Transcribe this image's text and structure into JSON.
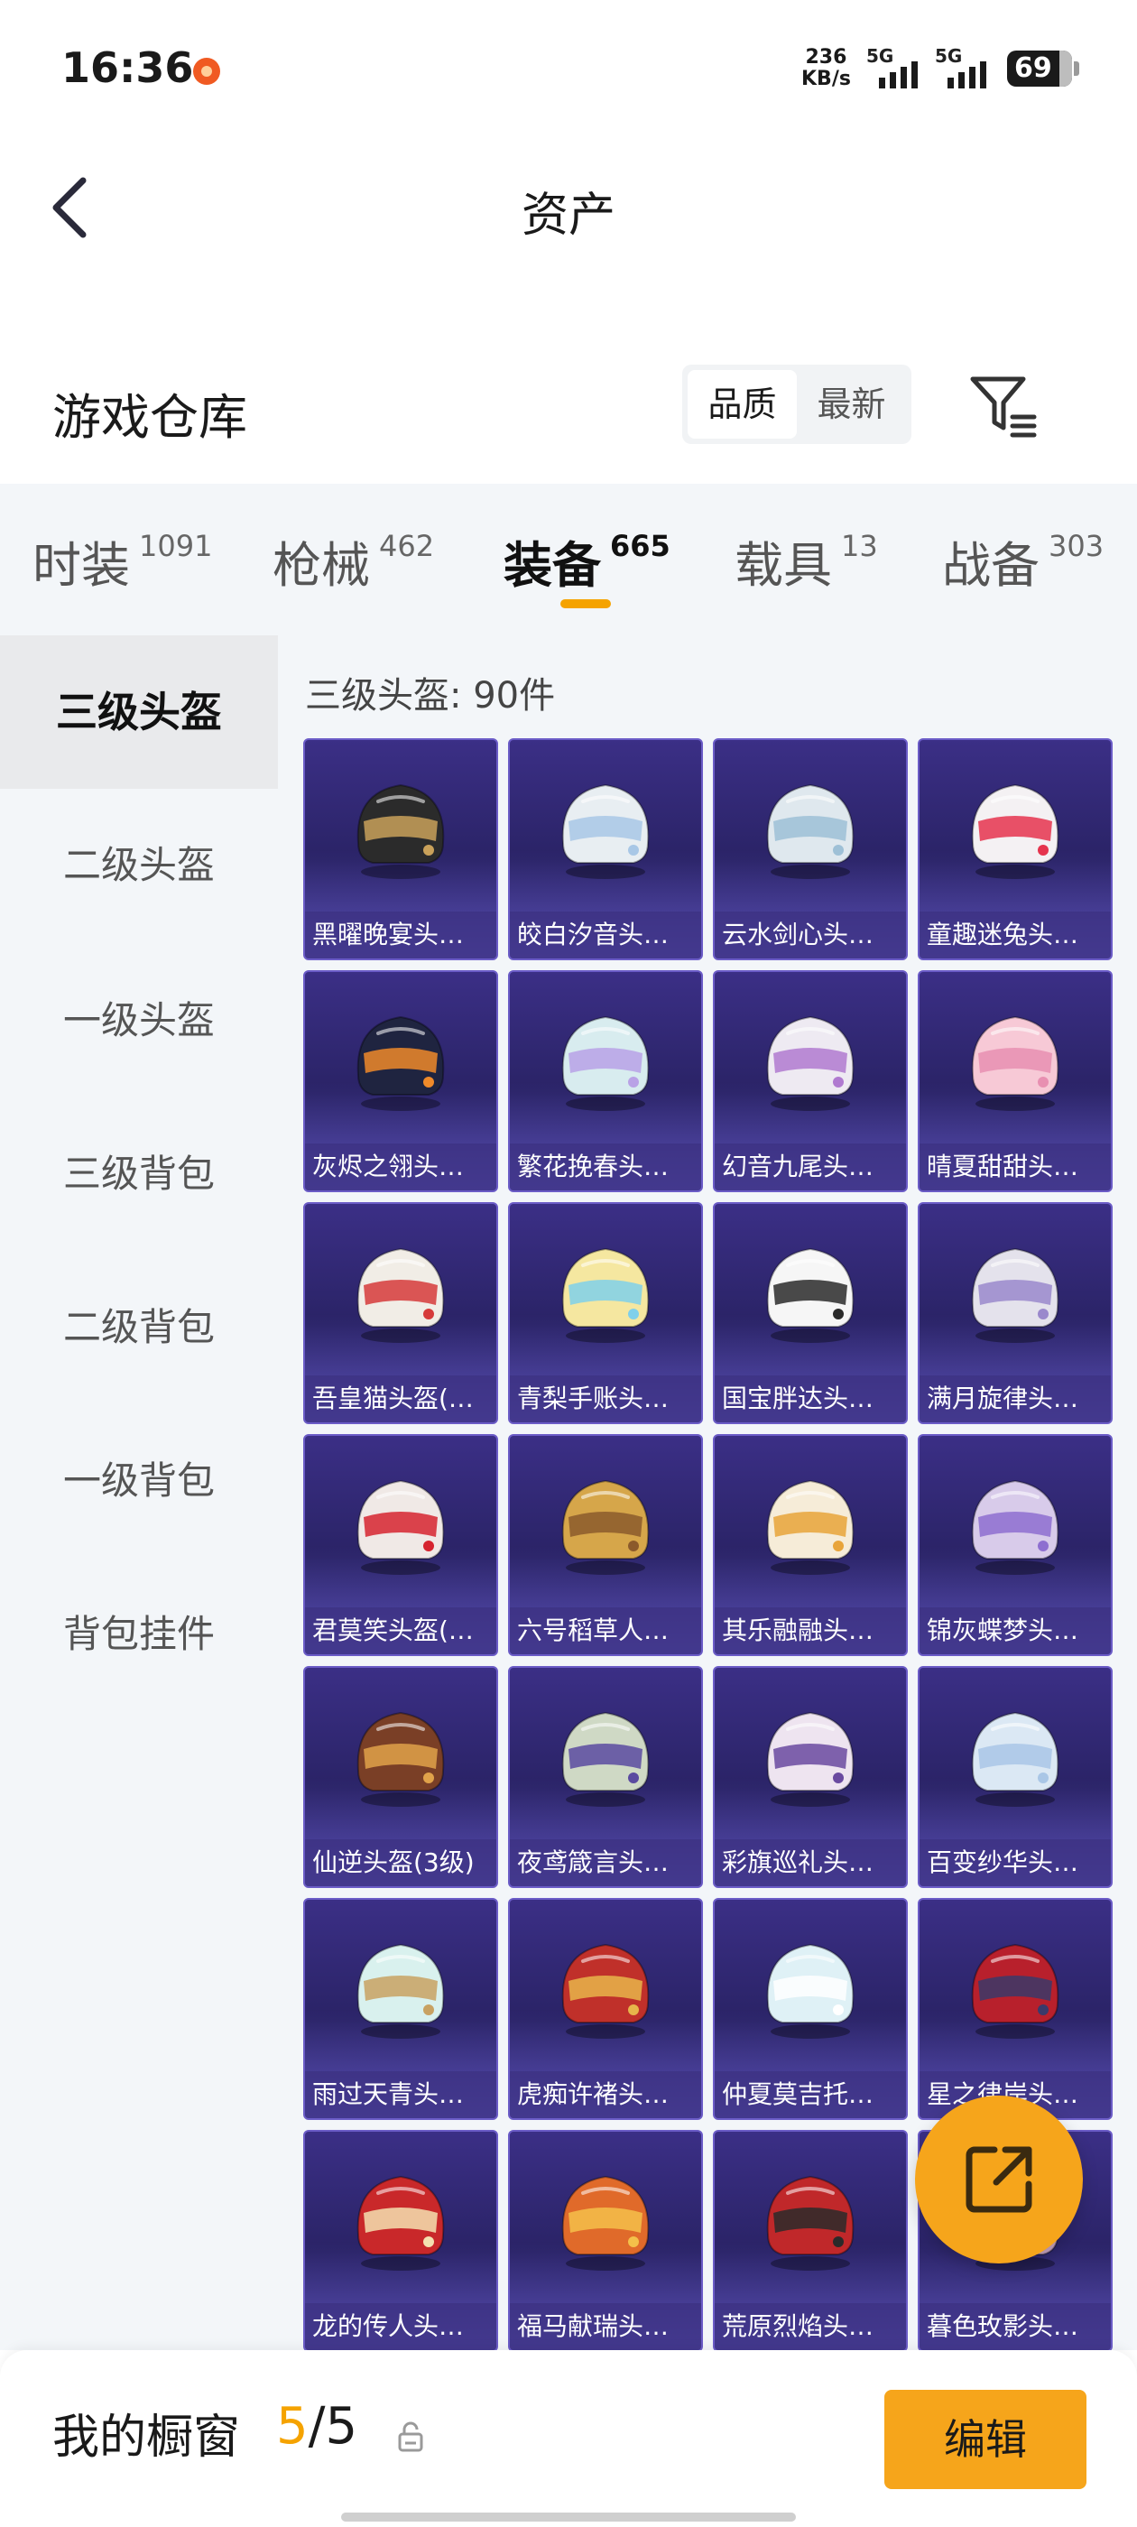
{
  "status_bar": {
    "time": "16:36",
    "net_speed_value": "236",
    "net_speed_unit": "KB/s",
    "signal1_label": "5G",
    "signal2_label": "5G",
    "battery": "69"
  },
  "header": {
    "title": "资产"
  },
  "warehouse": {
    "title": "游戏仓库",
    "sort_options": [
      "品质",
      "最新"
    ],
    "active_sort": "品质"
  },
  "tabs": [
    {
      "label": "时装",
      "count": "1091"
    },
    {
      "label": "枪械",
      "count": "462"
    },
    {
      "label": "装备",
      "count": "665"
    },
    {
      "label": "载具",
      "count": "13"
    },
    {
      "label": "战备",
      "count": "303"
    }
  ],
  "active_tab": "装备",
  "sidebar": {
    "items": [
      "三级头盔",
      "二级头盔",
      "一级头盔",
      "三级背包",
      "二级背包",
      "一级背包",
      "背包挂件"
    ],
    "active": "三级头盔"
  },
  "content": {
    "heading": "三级头盔: 90件",
    "items": [
      "黑曜晚宴头…",
      "皎白汐音头…",
      "云水剑心头…",
      "童趣迷兔头…",
      "灰烬之翎头…",
      "繁花挽春头…",
      "幻音九尾头…",
      "晴夏甜甜头…",
      "吾皇猫头盔(…",
      "青梨手账头…",
      "国宝胖达头…",
      "满月旋律头…",
      "君莫笑头盔(…",
      "六号稻草人…",
      "其乐融融头…",
      "锦灰蝶梦头…",
      "仙逆头盔(3级)",
      "夜鸢箴言头…",
      "彩旗巡礼头…",
      "百变纱华头…",
      "雨过天青头…",
      "虎痴许褚头…",
      "仲夏莫吉托…",
      "星之律岸头…",
      "龙的传人头…",
      "福马献瑞头…",
      "荒原烈焰头…",
      "暮色玫影头…"
    ],
    "helmet_colors": [
      "#2b2b2b",
      "#e8eef2",
      "#dfe8ee",
      "#f4f1f3",
      "#1f2440",
      "#d8ecef",
      "#eeeaf2",
      "#f7c9d6",
      "#f1ede6",
      "#f5e7a0",
      "#f6f6f6",
      "#e4e2ec",
      "#f0e9e6",
      "#d6a64a",
      "#f6ecd8",
      "#d8cbea",
      "#7a3f26",
      "#cfd9c5",
      "#eee4f0",
      "#dbe8f4",
      "#d9f1ee",
      "#c0302a",
      "#dff1f6",
      "#b8202c",
      "#c9282a",
      "#e06a2a",
      "#c0282a",
      "#c9a4c2"
    ],
    "accent_colors": [
      "#c9a15a",
      "#a8c7e6",
      "#9ec0d6",
      "#e5344d",
      "#f08a2a",
      "#b9a2e6",
      "#b07ad0",
      "#e88fb1",
      "#d63a3a",
      "#7fd0ea",
      "#2a2a2a",
      "#9a88cc",
      "#d6242f",
      "#8b5a2b",
      "#e8a43a",
      "#8e6fd0",
      "#e0a24a",
      "#5a4aa0",
      "#6a4aa0",
      "#a9c6e6",
      "#c8a262",
      "#e7b54a",
      "#ffffff",
      "#3a3a6a",
      "#f4e1b0",
      "#f4c04a",
      "#2a2a2a",
      "#e8c46a"
    ]
  },
  "bottom_bar": {
    "showcase_label": "我的橱窗",
    "showcase_current": "5",
    "showcase_total": "/5",
    "edit_label": "编辑"
  },
  "colors": {
    "accent": "#f6a51b",
    "card_bg": "#2e2670",
    "panel_bg": "#f3f6f9"
  }
}
